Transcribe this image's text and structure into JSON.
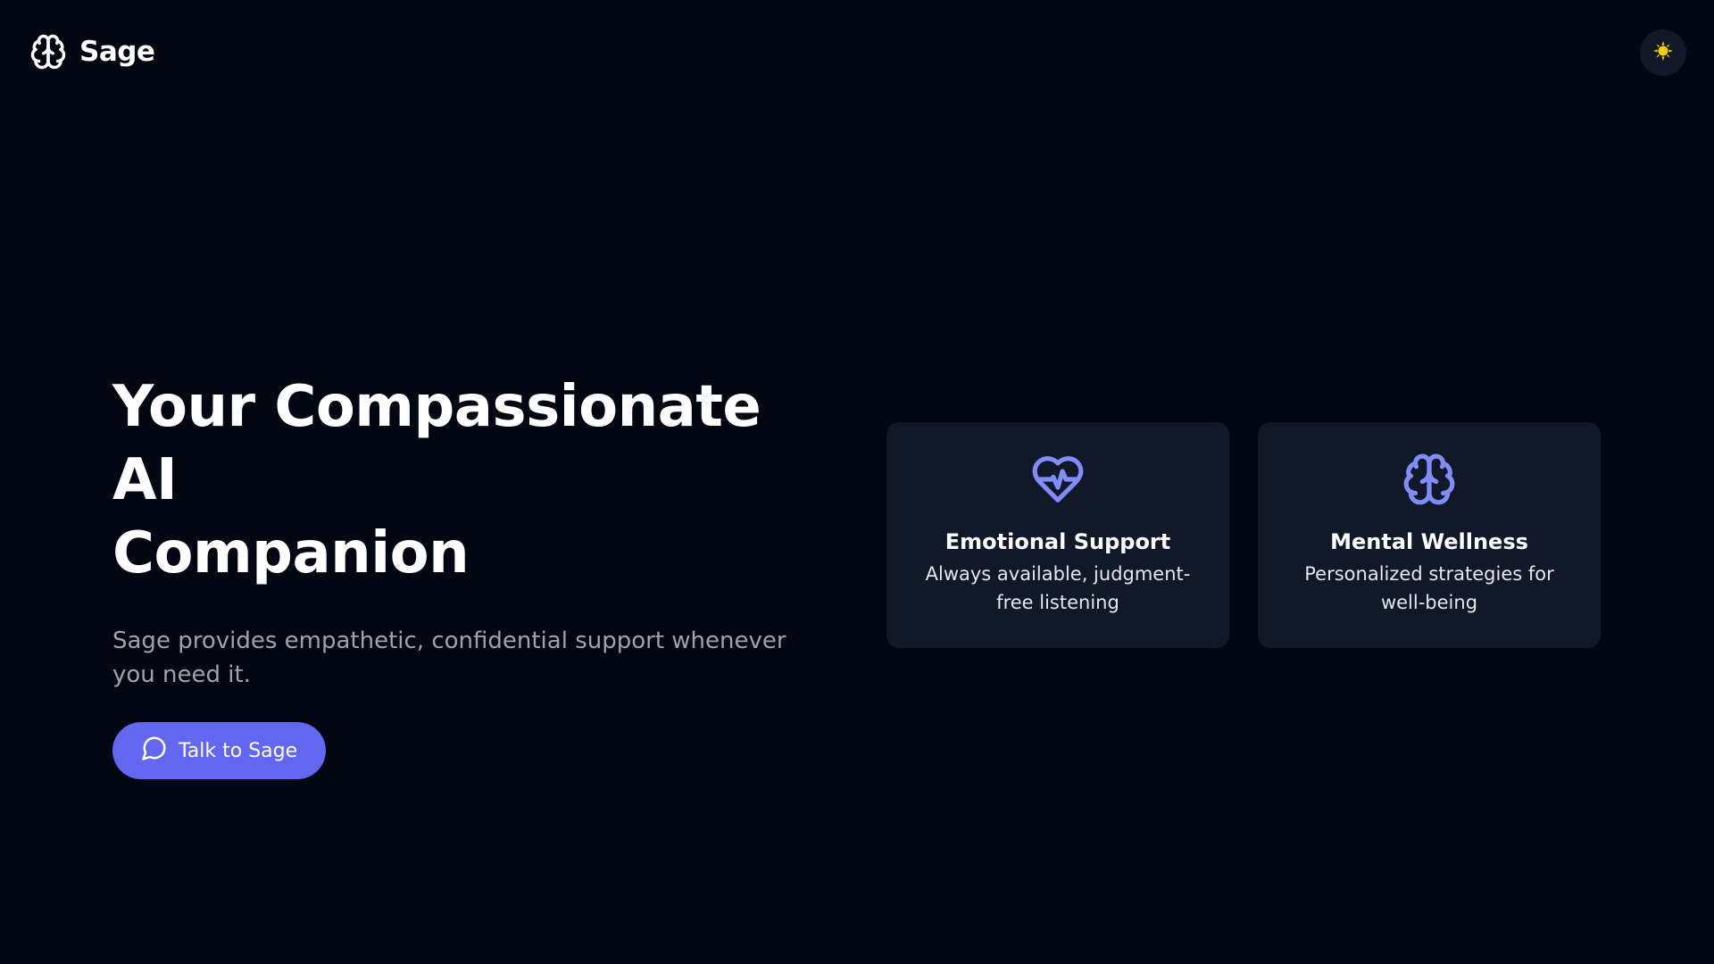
{
  "header": {
    "brand_name": "Sage",
    "brand_icon": "brain-icon",
    "theme_toggle_icon": "sun-icon"
  },
  "hero": {
    "title_line1": "Your Compassionate AI",
    "title_line2": "Companion",
    "subtitle": "Sage provides empathetic, confidential support whenever you need it.",
    "cta_label": "Talk to Sage",
    "cta_icon": "message-circle-icon"
  },
  "features": [
    {
      "icon": "heart-pulse-icon",
      "title": "Emotional Support",
      "description": "Always available, judgment-free listening"
    },
    {
      "icon": "brain-icon",
      "title": "Mental Wellness",
      "description": "Personalized strategies for well-being"
    }
  ],
  "colors": {
    "background": "#030712",
    "card_background": "#111827",
    "accent": "#6366f1",
    "icon_accent": "#818cf8",
    "sun": "#facc15",
    "subtitle_text": "#9ca3af"
  }
}
